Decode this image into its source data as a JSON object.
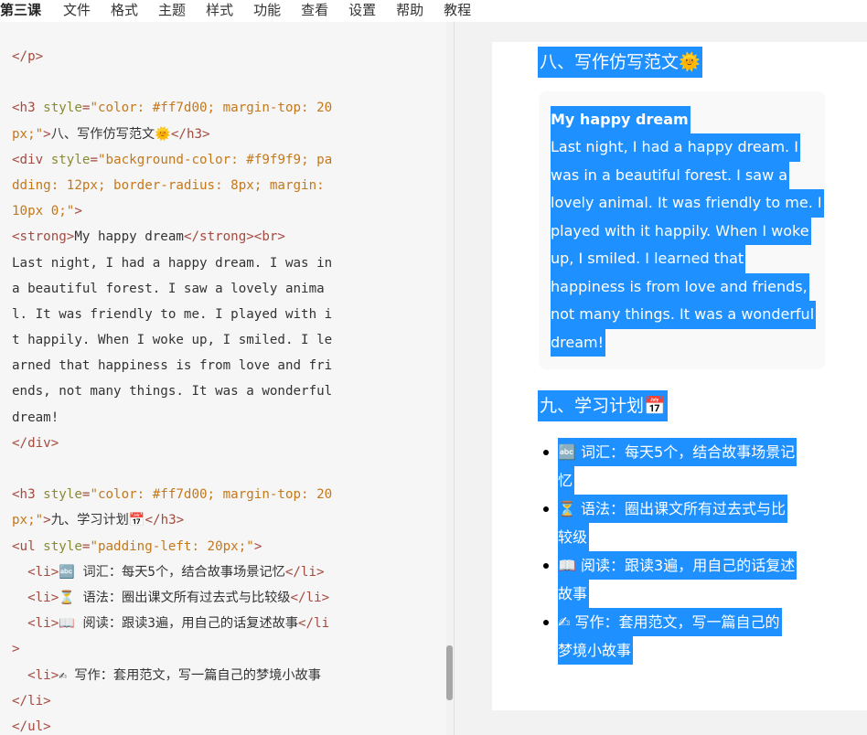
{
  "menu": {
    "title": "第三课",
    "items": [
      "文件",
      "格式",
      "主题",
      "样式",
      "功能",
      "查看",
      "设置",
      "帮助",
      "教程"
    ]
  },
  "editor": {
    "lines": [
      [
        {
          "c": "tag",
          "t": "</p>"
        }
      ],
      [],
      [
        {
          "c": "tag",
          "t": "<h3 "
        },
        {
          "c": "attr",
          "t": "style"
        },
        {
          "c": "tag",
          "t": "="
        },
        {
          "c": "str",
          "t": "\"color: #ff7d00; margin-top: 20"
        }
      ],
      [
        {
          "c": "str",
          "t": "px;\""
        },
        {
          "c": "tag",
          "t": ">"
        },
        {
          "c": "txt",
          "t": "八、写作仿写范文🌞"
        },
        {
          "c": "tag",
          "t": "</h3>"
        }
      ],
      [
        {
          "c": "tag",
          "t": "<div "
        },
        {
          "c": "attr",
          "t": "style"
        },
        {
          "c": "tag",
          "t": "="
        },
        {
          "c": "str",
          "t": "\"background-color: #f9f9f9; pa"
        }
      ],
      [
        {
          "c": "str",
          "t": "dding: 12px; border-radius: 8px; margin:"
        }
      ],
      [
        {
          "c": "str",
          "t": "10px 0;\""
        },
        {
          "c": "tag",
          "t": ">"
        }
      ],
      [
        {
          "c": "tag",
          "t": "<strong>"
        },
        {
          "c": "txt",
          "t": "My happy dream"
        },
        {
          "c": "tag",
          "t": "</strong><br>"
        }
      ],
      [
        {
          "c": "txt",
          "t": "Last night, I had a happy dream. I was in"
        }
      ],
      [
        {
          "c": "txt",
          "t": "a beautiful forest. I saw a lovely anima"
        }
      ],
      [
        {
          "c": "txt",
          "t": "l. It was friendly to me. I played with i"
        }
      ],
      [
        {
          "c": "txt",
          "t": "t happily. When I woke up, I smiled. I le"
        }
      ],
      [
        {
          "c": "txt",
          "t": "arned that happiness is from love and fri"
        }
      ],
      [
        {
          "c": "txt",
          "t": "ends, not many things. It was a wonderful"
        }
      ],
      [
        {
          "c": "txt",
          "t": "dream!"
        }
      ],
      [
        {
          "c": "tag",
          "t": "</div>"
        }
      ],
      [],
      [
        {
          "c": "tag",
          "t": "<h3 "
        },
        {
          "c": "attr",
          "t": "style"
        },
        {
          "c": "tag",
          "t": "="
        },
        {
          "c": "str",
          "t": "\"color: #ff7d00; margin-top: 20"
        }
      ],
      [
        {
          "c": "str",
          "t": "px;\""
        },
        {
          "c": "tag",
          "t": ">"
        },
        {
          "c": "txt",
          "t": "九、学习计划📅"
        },
        {
          "c": "tag",
          "t": "</h3>"
        }
      ],
      [
        {
          "c": "tag",
          "t": "<ul "
        },
        {
          "c": "attr",
          "t": "style"
        },
        {
          "c": "tag",
          "t": "="
        },
        {
          "c": "str",
          "t": "\"padding-left: 20px;\""
        },
        {
          "c": "tag",
          "t": ">"
        }
      ],
      [
        {
          "c": "txt",
          "t": "  "
        },
        {
          "c": "tag",
          "t": "<li>"
        },
        {
          "c": "txt",
          "t": "🔤 词汇：每天5个，结合故事场景记忆"
        },
        {
          "c": "tag",
          "t": "</li>"
        }
      ],
      [
        {
          "c": "txt",
          "t": "  "
        },
        {
          "c": "tag",
          "t": "<li>"
        },
        {
          "c": "txt",
          "t": "⏳ 语法：圈出课文所有过去式与比较级"
        },
        {
          "c": "tag",
          "t": "</li>"
        }
      ],
      [
        {
          "c": "txt",
          "t": "  "
        },
        {
          "c": "tag",
          "t": "<li>"
        },
        {
          "c": "txt",
          "t": "📖 阅读：跟读3遍，用自己的话复述故事"
        },
        {
          "c": "tag",
          "t": "</li"
        }
      ],
      [
        {
          "c": "tag",
          "t": ">"
        }
      ],
      [
        {
          "c": "txt",
          "t": "  "
        },
        {
          "c": "tag",
          "t": "<li>"
        },
        {
          "c": "txt",
          "t": "✍ 写作：套用范文，写一篇自己的梦境小故事"
        }
      ],
      [
        {
          "c": "tag",
          "t": "</li>"
        }
      ],
      [
        {
          "c": "tag",
          "t": "</ul>"
        }
      ]
    ]
  },
  "preview": {
    "h3_writing": "八、写作仿写范文🌞",
    "story_title": "My happy dream",
    "story_lines": [
      "Last night, I had a happy dream. I",
      "was in a beautiful forest. I saw a",
      "lovely animal. It was friendly to me. I",
      "played with it happily. When I woke",
      "up, I smiled. I learned that",
      "happiness is from love and friends,",
      "not many things. It was a wonderful",
      "dream!"
    ],
    "h3_plan": "九、学习计划📅",
    "plan_items": [
      [
        "🔤 词汇：每天5个，结合故事场景记",
        "忆"
      ],
      [
        "⏳ 语法：圈出课文所有过去式与比",
        "较级"
      ],
      [
        "📖 阅读：跟读3遍，用自己的话复述",
        "故事"
      ],
      [
        "✍ 写作：套用范文，写一篇自己的",
        "梦境小故事"
      ]
    ]
  },
  "colors": {
    "selection": "#1e90ff",
    "tag": "#a44a3f",
    "attr": "#8a8a30",
    "string": "#c4781c"
  }
}
